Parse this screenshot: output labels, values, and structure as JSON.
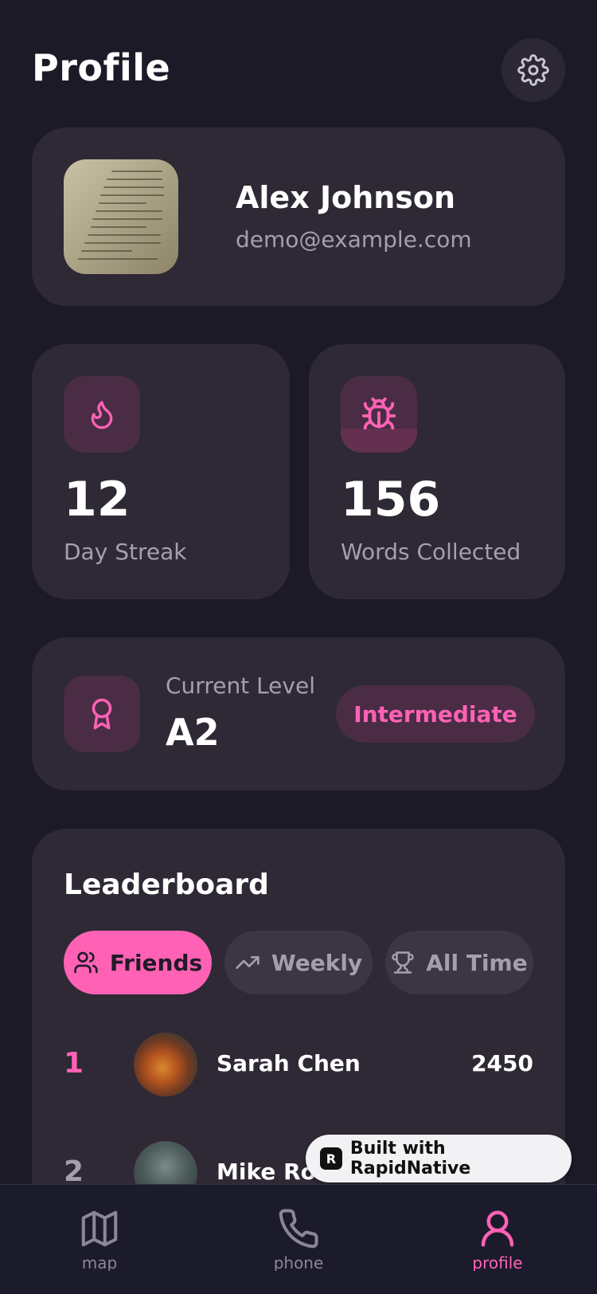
{
  "header": {
    "title": "Profile",
    "settings_icon": "gear-icon"
  },
  "profile": {
    "name": "Alex Johnson",
    "email": "demo@example.com"
  },
  "stats": [
    {
      "icon": "flame-icon",
      "value": "12",
      "label": "Day Streak"
    },
    {
      "icon": "bug-icon",
      "value": "156",
      "label": "Words Collected"
    }
  ],
  "level": {
    "icon": "award-icon",
    "caption": "Current Level",
    "value": "A2",
    "badge": "Intermediate"
  },
  "leaderboard": {
    "title": "Leaderboard",
    "tabs": [
      {
        "label": "Friends",
        "icon": "users-icon",
        "active": true
      },
      {
        "label": "Weekly",
        "icon": "trending-up-icon",
        "active": false
      },
      {
        "label": "All Time",
        "icon": "trophy-icon",
        "active": false
      }
    ],
    "rows": [
      {
        "rank": "1",
        "name": "Sarah Chen",
        "score": "2450"
      },
      {
        "rank": "2",
        "name": "Mike Ross",
        "score": ""
      }
    ]
  },
  "built_badge": {
    "label": "Built with RapidNative",
    "logo": "R"
  },
  "nav": [
    {
      "label": "map",
      "icon": "map-icon",
      "active": false
    },
    {
      "label": "phone",
      "icon": "phone-icon",
      "active": false
    },
    {
      "label": "profile",
      "icon": "user-icon",
      "active": true
    }
  ],
  "colors": {
    "background": "#1d1a27",
    "card": "#2e2935",
    "accent": "#ff62b4",
    "muted_text": "#a49fb0"
  }
}
